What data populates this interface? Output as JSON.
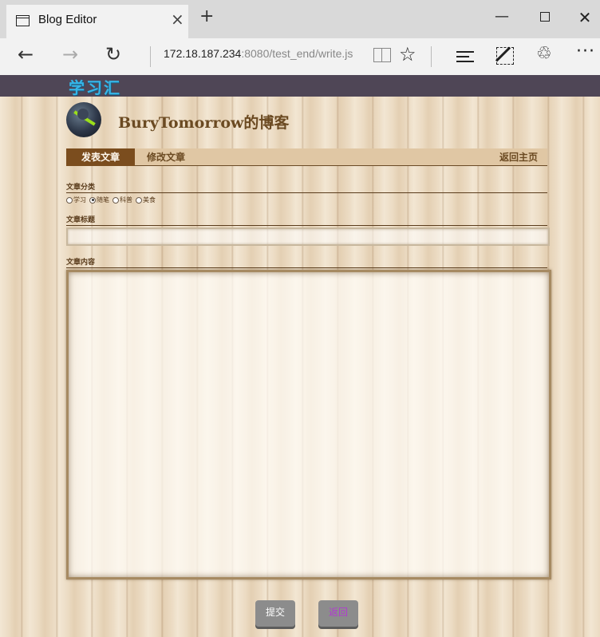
{
  "browser": {
    "tab_title": "Blog Editor",
    "tab_close": "×",
    "new_tab": "+",
    "window": {
      "minimize": "—",
      "close": "✕"
    },
    "nav": {
      "back": "←",
      "forward": "→",
      "refresh": "↻"
    },
    "address_host": "172.18.187.234",
    "address_rest": ":8080/test_end/write.js",
    "favorite": "☆",
    "share": "♲",
    "more": "···"
  },
  "site": {
    "logo": "学习汇",
    "blog_title": "BuryTomorrow的博客"
  },
  "menu": {
    "active": "发表文章",
    "edit": "修改文章",
    "home": "返回主页"
  },
  "form": {
    "category_label": "文章分类",
    "categories": [
      {
        "label": "学习",
        "checked": false
      },
      {
        "label": "随笔",
        "checked": true
      },
      {
        "label": "科普",
        "checked": false
      },
      {
        "label": "美食",
        "checked": false
      }
    ],
    "title_label": "文章标题",
    "title_value": "",
    "content_label": "文章内容",
    "content_value": ""
  },
  "buttons": {
    "submit": "提交",
    "back": "返回"
  },
  "colors": {
    "topbar": "#4f4656",
    "logo": "#36b6e8",
    "menu_active_bg": "#7b4d1e",
    "menu_bg": "#e0c7a4",
    "text_brown": "#6b4a22",
    "button_bg": "#8c8c8c",
    "back_text": "#b23ad0"
  }
}
